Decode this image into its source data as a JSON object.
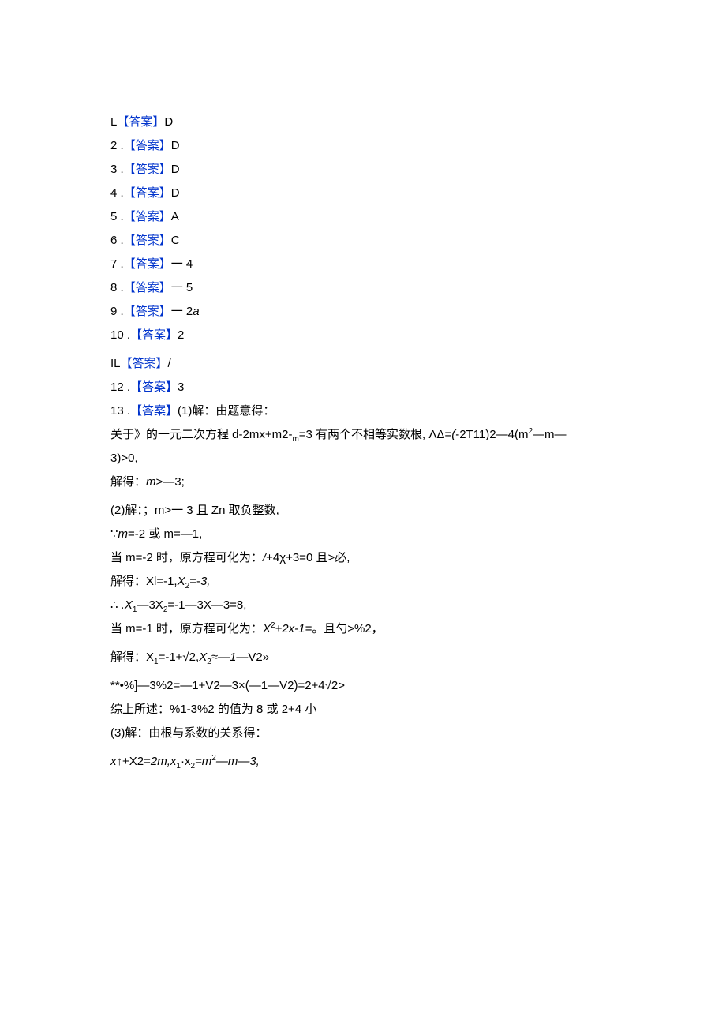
{
  "answer_label": "【答案】",
  "lines": [
    {
      "prefix": "L",
      "type": "answer",
      "value": "D"
    },
    {
      "prefix": "2  .",
      "type": "answer",
      "value": "D"
    },
    {
      "prefix": "3  .",
      "type": "answer",
      "value": "D"
    },
    {
      "prefix": "4  .",
      "type": "answer",
      "value": "D"
    },
    {
      "prefix": "5  .",
      "type": "answer",
      "value": "A"
    },
    {
      "prefix": "6  .",
      "type": "answer",
      "value": "C"
    },
    {
      "prefix": "7  .",
      "type": "answer",
      "value": "一 4"
    },
    {
      "prefix": "8  .",
      "type": "answer",
      "value": "一 5"
    },
    {
      "prefix": "9  .",
      "type": "answer_mixed",
      "plain": "一 2",
      "ital": "a"
    },
    {
      "prefix": "10   .",
      "type": "answer",
      "value": "2"
    },
    {
      "type": "gap"
    },
    {
      "prefix": "IL",
      "type": "answer",
      "value": "/"
    },
    {
      "prefix": "12   .",
      "type": "answer",
      "value": "3"
    },
    {
      "type": "q13_header",
      "prefix": "13   .",
      "text": "(1)解：由题意得："
    },
    {
      "type": "q13_line1_a",
      "pre": "关于》的一元二次方程 d-2mx+m2-",
      "sub": "m",
      "mid": "=3 有两个不相等实数根, ",
      "sc": "ΛΔ",
      "eq": "=",
      "ital1": "(",
      "post": "-2T11)2—4(m",
      "sup": "2",
      "tail": "—m—"
    },
    {
      "type": "plain",
      "text": "3)>0,"
    },
    {
      "type": "solve_m",
      "pre": "解得：",
      "ital": "m",
      "post": ">—3;"
    },
    {
      "type": "gap"
    },
    {
      "type": "plain",
      "text": "(2)解：；m>一 3 且 Zn 取负整数,"
    },
    {
      "type": "mline",
      "pre": "∵",
      "ital": "m",
      "post": "=-2 或 m=—1,"
    },
    {
      "type": "mline2",
      "pre": "当 m=-2 时，原方程可化为：",
      "ital": "/",
      "post": "+4χ+3=0 且>必,"
    },
    {
      "type": "solve_x12",
      "pre": "解得：Xl=-1,",
      "x2": "X",
      "sub2": "2",
      "post": "=-",
      "ital_end": "3,"
    },
    {
      "type": "x1_3x2",
      "pre": "∴  ",
      "x1i": ".X",
      "sub1": "1",
      "mid": "—3X",
      "sub2": "2",
      "post": "=-1—3X—3=8,"
    },
    {
      "type": "when_m1",
      "pre": "当 m=-1 时，原方程可化为：",
      "ital": "X",
      "sup": "2",
      "p2": "+2x-1=",
      "tail": "。且勺>%2，"
    },
    {
      "type": "gap"
    },
    {
      "type": "solve_x12b",
      "pre": "解得：X",
      "sub1": "1",
      "mid": "=-1+√2,",
      "x2i": "X",
      "sub2": "2",
      "p2i": "≈—1",
      "tail": "—V2»"
    },
    {
      "type": "gap"
    },
    {
      "type": "plain",
      "text": "**•%]—3%2=—1+V2—3×(—1—V2)=2+4√2>"
    },
    {
      "type": "plain",
      "text": "综上所述：%1-3%2 的值为 8 或 2+4 小"
    },
    {
      "type": "plain",
      "text": "(3)解：由根与系数的关系得："
    },
    {
      "type": "gap"
    },
    {
      "type": "vieta",
      "xi": "x",
      "t1": "↑+X2=",
      "i2": "2m,x",
      "sub1": "1",
      "mid": "·x",
      "sub2": "2",
      "i3": "=m",
      "sup": "2",
      "tail": "—m—3,"
    }
  ]
}
